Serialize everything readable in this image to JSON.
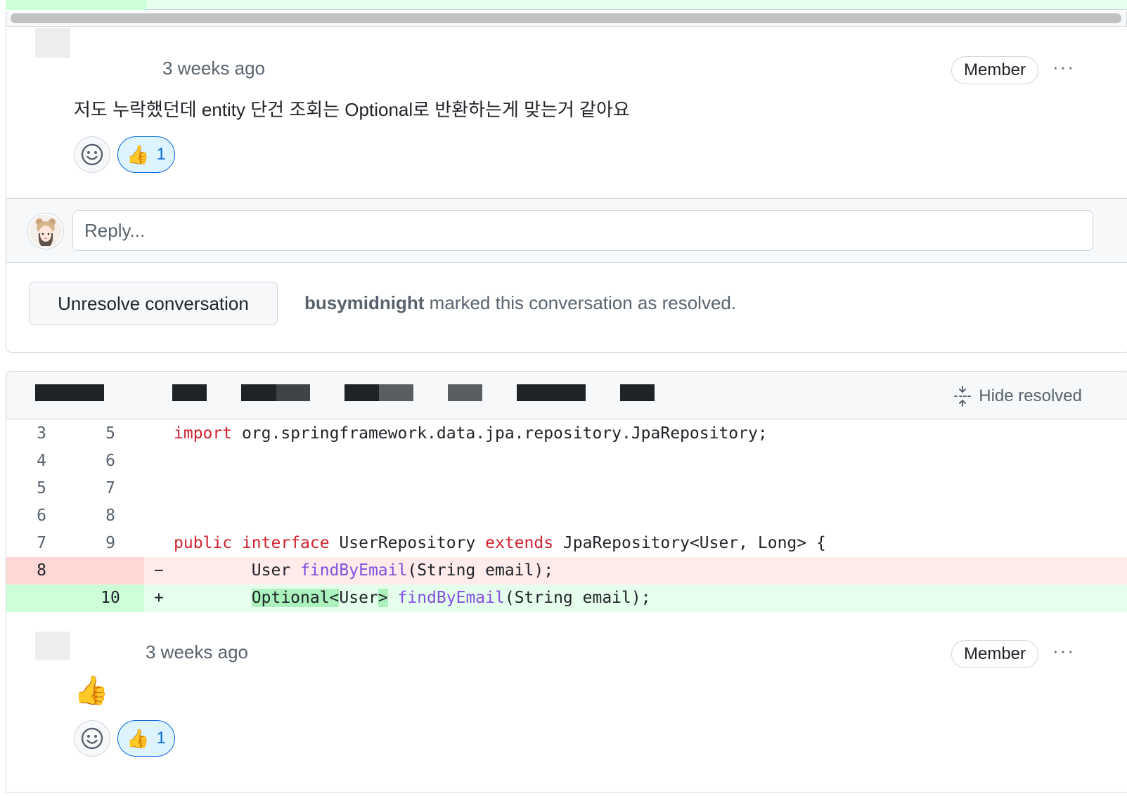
{
  "thread1": {
    "comment": {
      "timestamp": "3 weeks ago",
      "badge": "Member",
      "menu": "···",
      "body": "저도 누락했던데 entity 단건 조회는 Optional로 반환하는게 맞는거 같아요",
      "reaction_emoji": "👍",
      "reaction_count": "1"
    },
    "reply_placeholder": "Reply...",
    "unresolve_label": "Unresolve conversation",
    "resolved_user": "busymidnight",
    "resolved_text": "marked this conversation as resolved."
  },
  "thread2": {
    "hide_resolved_label": "Hide resolved",
    "diff_lines": [
      {
        "old": "3",
        "new": "5",
        "sign": "",
        "type": "ctx",
        "tokens": [
          {
            "t": "import",
            "c": "kw"
          },
          {
            "t": " org.springframework.data.jpa.repository.JpaRepository;",
            "c": ""
          }
        ]
      },
      {
        "old": "4",
        "new": "6",
        "sign": "",
        "type": "ctx",
        "tokens": []
      },
      {
        "old": "5",
        "new": "7",
        "sign": "",
        "type": "ctx",
        "tokens": []
      },
      {
        "old": "6",
        "new": "8",
        "sign": "",
        "type": "ctx",
        "tokens": []
      },
      {
        "old": "7",
        "new": "9",
        "sign": "",
        "type": "ctx",
        "tokens": [
          {
            "t": "public",
            "c": "kw"
          },
          {
            "t": " ",
            "c": ""
          },
          {
            "t": "interface",
            "c": "kw"
          },
          {
            "t": " UserRepository ",
            "c": ""
          },
          {
            "t": "extends",
            "c": "kw"
          },
          {
            "t": " JpaRepository<User, Long> {",
            "c": ""
          }
        ]
      },
      {
        "old": "8",
        "new": "",
        "sign": "−",
        "type": "del",
        "tokens": [
          {
            "t": "        User ",
            "c": ""
          },
          {
            "t": "findByEmail",
            "c": "fn"
          },
          {
            "t": "(String email);",
            "c": ""
          }
        ]
      },
      {
        "old": "",
        "new": "10",
        "sign": "+",
        "type": "add",
        "tokens": [
          {
            "t": "        ",
            "c": ""
          },
          {
            "t": "Optional<",
            "c": "hl"
          },
          {
            "t": "User",
            "c": ""
          },
          {
            "t": ">",
            "c": "hl"
          },
          {
            "t": " ",
            "c": ""
          },
          {
            "t": "findByEmail",
            "c": "fn"
          },
          {
            "t": "(String email);",
            "c": ""
          }
        ]
      }
    ],
    "comment": {
      "timestamp": "3 weeks ago",
      "badge": "Member",
      "menu": "···",
      "body_emoji": "👍",
      "reaction_emoji": "👍",
      "reaction_count": "1"
    }
  }
}
